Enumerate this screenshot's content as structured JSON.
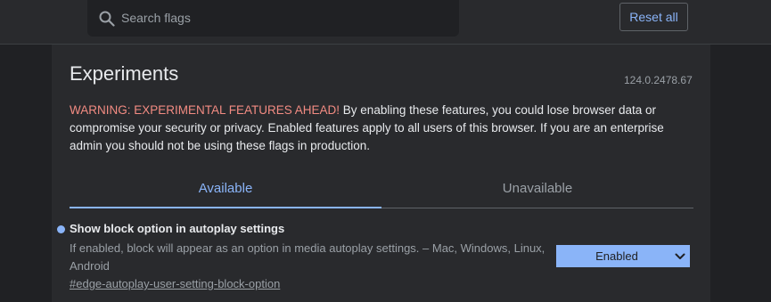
{
  "search": {
    "placeholder": "Search flags",
    "value": ""
  },
  "toolbar": {
    "reset_label": "Reset all"
  },
  "page": {
    "title": "Experiments",
    "version": "124.0.2478.67",
    "warning_strong": "WARNING: EXPERIMENTAL FEATURES AHEAD!",
    "warning_text": " By enabling these features, you could lose browser data or compromise your security or privacy. Enabled features apply to all users of this browser. If you are an enterprise admin you should not be using these flags in production."
  },
  "tabs": [
    {
      "label": "Available",
      "active": true
    },
    {
      "label": "Unavailable",
      "active": false
    }
  ],
  "flags": [
    {
      "title": "Show block option in autoplay settings",
      "description": "If enabled, block will appear as an option in media autoplay settings. – Mac, Windows, Linux, Android",
      "link": "#edge-autoplay-user-setting-block-option",
      "selected_value": "Enabled"
    }
  ],
  "colors": {
    "accent": "#8ab4f8",
    "warning": "#f28b82",
    "background": "#202124",
    "panel": "#292a2d"
  },
  "icons": {
    "search": "search-icon",
    "dropdown": "chevron-down-icon",
    "modified": "modified-dot-icon"
  }
}
